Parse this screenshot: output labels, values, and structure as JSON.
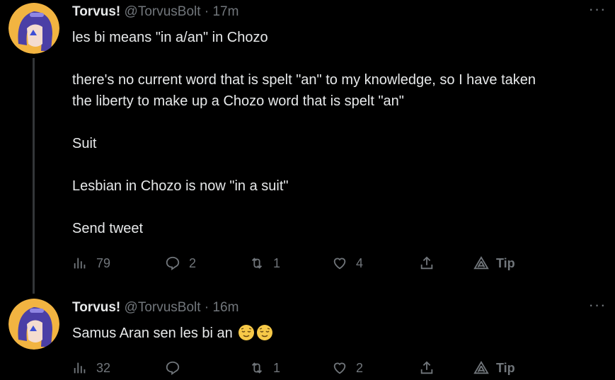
{
  "tweets": [
    {
      "name": "Torvus!",
      "handle": "@TorvusBolt",
      "separator": "·",
      "time": "17m",
      "lines": [
        "les bi means \"in a/an\" in Chozo",
        "",
        "there's no current word that is spelt \"an\" to my knowledge, so I have taken",
        "the liberty to make up a Chozo word that is spelt \"an\"",
        "",
        "Suit",
        "",
        "Lesbian in Chozo is now \"in a suit\"",
        "",
        "Send tweet"
      ],
      "views": "79",
      "replies": "2",
      "retweets": "1",
      "likes": "4",
      "tip_label": "Tip",
      "more_label": "···"
    },
    {
      "name": "Torvus!",
      "handle": "@TorvusBolt",
      "separator": "·",
      "time": "16m",
      "text": "Samus Aran sen les bi an",
      "emojis": [
        "relieved-face-emoji",
        "relieved-face-emoji"
      ],
      "views": "32",
      "replies": "",
      "retweets": "1",
      "likes": "2",
      "tip_label": "Tip",
      "more_label": "···"
    }
  ],
  "colors": {
    "background": "#000000",
    "text": "#e7e9ea",
    "muted": "#71767b",
    "thread_line": "#333639",
    "avatar_bg": "#f2b441",
    "avatar_hair": "#4b3fa6",
    "emoji": "#f7c948"
  }
}
